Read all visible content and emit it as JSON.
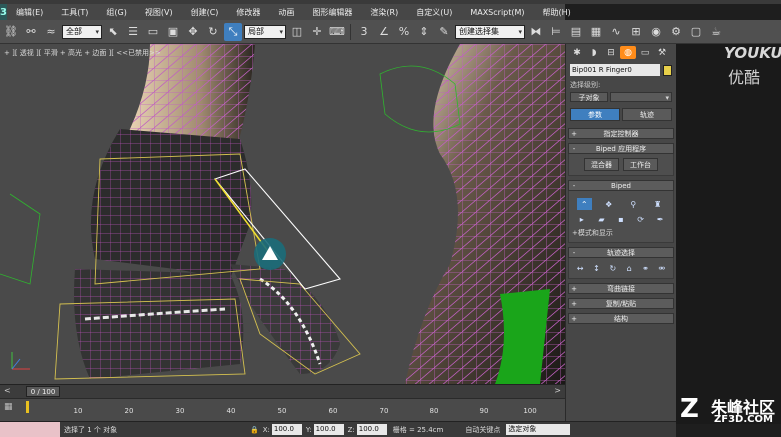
{
  "window": {
    "title": ""
  },
  "menubar": {
    "logo": "3",
    "items": [
      "编辑(E)",
      "工具(T)",
      "组(G)",
      "视图(V)",
      "创建(C)",
      "修改器",
      "动画",
      "图形编辑器",
      "渲染(R)",
      "自定义(U)",
      "MAXScript(M)",
      "帮助(H)"
    ]
  },
  "toolbar": {
    "filter_dropdown": "全部",
    "refcoord_dropdown": "局部",
    "named_selection": "创建选择集",
    "snap_label": "3",
    "percent_label": "%"
  },
  "viewport": {
    "label": "+ ][ 透视 ][ 平滑 + 高光 + 边面 ][ <<已禁用>>",
    "colors": {
      "skin": "#e6d3b3",
      "wire": "#c060c0",
      "bone": "#d4c050",
      "glove": "#2a2a2a",
      "bg": "#4a4a4a",
      "green": "#1aa51a"
    }
  },
  "command_panel": {
    "tabs": [
      "create-icon",
      "modify-icon",
      "hierarchy-icon",
      "motion-icon",
      "display-icon",
      "utilities-icon"
    ],
    "object_name": "Bip001 R Finger0",
    "selection_level_label": "选择级别:",
    "sub_object_button": "子对象",
    "mode_tabs": [
      "参数",
      "轨迹"
    ],
    "rollouts": {
      "assign_controller": "指定控制器",
      "biped_apps": "Biped 应用程序",
      "mixer_button": "混合器",
      "workbench_button": "工作台",
      "biped": "Biped",
      "mode_display": "模式和显示",
      "track_selection": "轨迹选择",
      "bend_links": "弯曲链接",
      "copy_paste": "复制/粘贴",
      "structure": "结构"
    },
    "signs": {
      "plus": "+",
      "minus": "-"
    }
  },
  "watermarks": {
    "youku": "YOUKU",
    "youku_cn": "优酷",
    "zf3d_cn": "朱峰社区",
    "zf3d_en": "ZF3D.COM"
  },
  "timeline": {
    "position": "0 / 100",
    "prev": "<",
    "next": ">",
    "ticks": [
      "10",
      "20",
      "30",
      "40",
      "50",
      "60",
      "70",
      "80",
      "90",
      "100"
    ]
  },
  "status": {
    "message": "选择了 1 个 对象",
    "x_label": "X:",
    "x_value": "100.0",
    "y_label": "Y:",
    "y_value": "100.0",
    "z_label": "Z:",
    "z_value": "100.0",
    "grid": "栅格 = 25.4cm",
    "autokey": "自动关键点",
    "key_filter": "选定对象"
  }
}
